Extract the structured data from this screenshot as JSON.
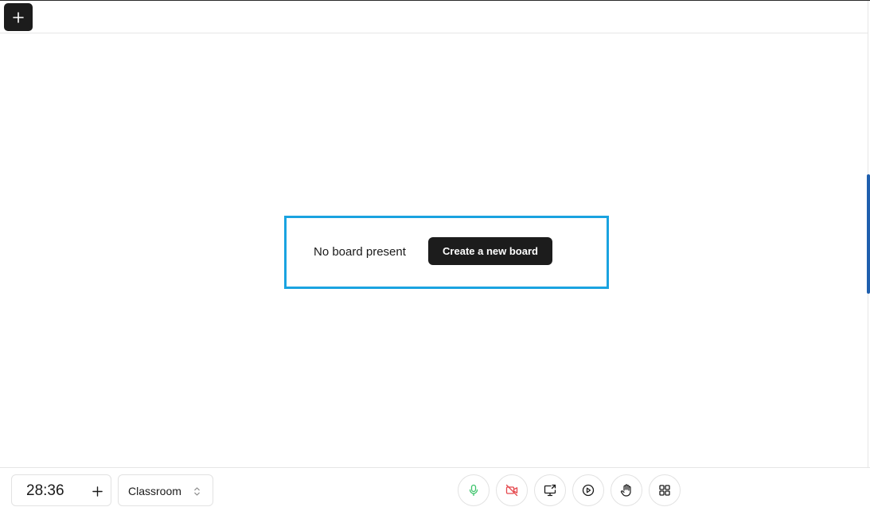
{
  "topbar": {
    "add_icon": "plus-icon"
  },
  "board": {
    "empty_text": "No board present",
    "create_label": "Create a new board",
    "highlight_color": "#1aa3e0"
  },
  "bottombar": {
    "timer": "28:36",
    "timer_add_icon": "plus-icon",
    "room": {
      "selected": "Classroom",
      "icon": "chevrons-up-down-icon"
    },
    "controls": [
      {
        "name": "mic-button",
        "icon": "microphone-icon",
        "color": "#3cc46b",
        "state": "on"
      },
      {
        "name": "camera-button",
        "icon": "video-off-icon",
        "color": "#e5484d",
        "state": "off"
      },
      {
        "name": "screen-share-button",
        "icon": "screen-share-icon",
        "color": "#1a1a1a"
      },
      {
        "name": "play-button",
        "icon": "play-circle-icon",
        "color": "#1a1a1a"
      },
      {
        "name": "raise-hand-button",
        "icon": "hand-icon",
        "color": "#1a1a1a"
      },
      {
        "name": "apps-button",
        "icon": "grid-icon",
        "color": "#1a1a1a"
      }
    ]
  }
}
